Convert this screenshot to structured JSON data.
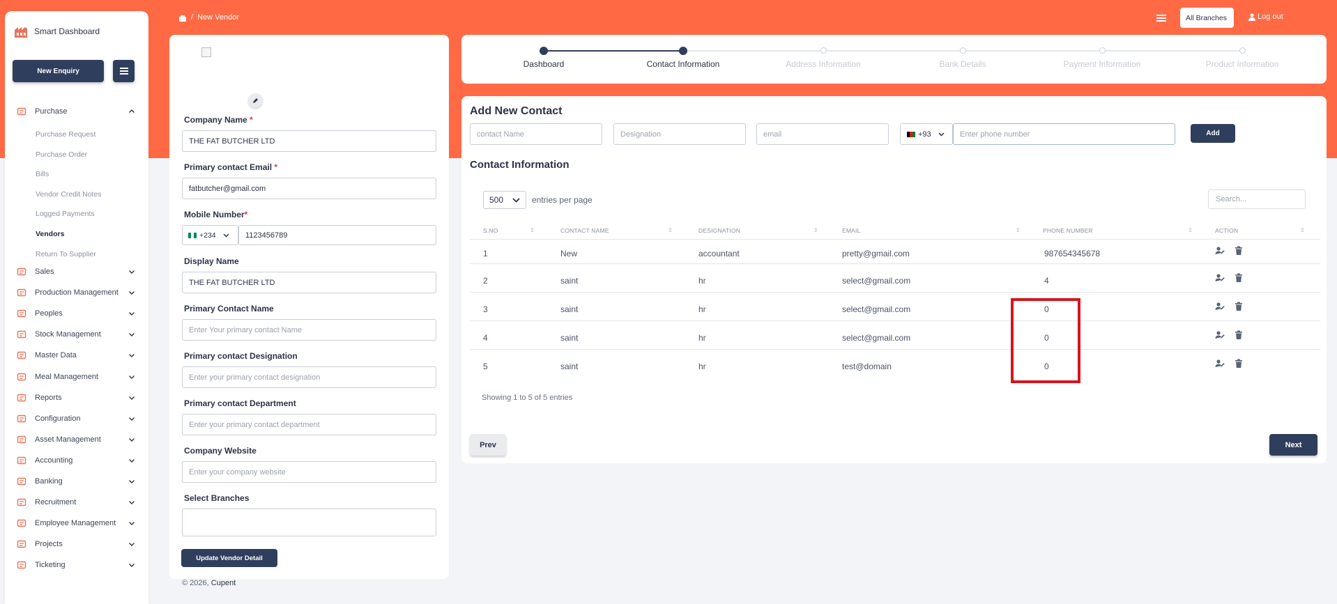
{
  "brand": {
    "name": "Smart Dashboard"
  },
  "sidebar": {
    "new_enquiry": "New Enquiry",
    "purchase": {
      "label": "Purchase",
      "subitems": [
        "Purchase Request",
        "Purchase Order",
        "Bills",
        "Vendor Credit Notes",
        "Logged Payments",
        "Vendors",
        "Return To Supplier"
      ],
      "active": "Vendors"
    },
    "items": [
      "Sales",
      "Production Management",
      "Peoples",
      "Stock Management",
      "Master Data",
      "Meal Management",
      "Reports",
      "Configuration",
      "Asset Management",
      "Accounting",
      "Banking",
      "Recruitment",
      "Employee Management",
      "Projects",
      "Ticketing"
    ]
  },
  "header": {
    "breadcrumb_sep": "/",
    "breadcrumb": "New Vendor",
    "branch_select": "All Branches",
    "logout": "Log out"
  },
  "vendor_form": {
    "company_name": {
      "label": "Company Name",
      "req": "*",
      "value": "THE FAT BUTCHER LTD"
    },
    "email": {
      "label": "Primary contact Email",
      "req": "*",
      "value": "fatbutcher@gmail.com"
    },
    "mobile": {
      "label": "Mobile Number",
      "req": "*",
      "code": "+234",
      "value": "1123456789"
    },
    "display_name": {
      "label": "Display Name",
      "value": "THE FAT BUTCHER LTD"
    },
    "contact_name": {
      "label": "Primary Contact Name",
      "placeholder": "Enter Your primary contact Name"
    },
    "designation": {
      "label": "Primary contact Designation",
      "placeholder": "Enter your primary contact designation"
    },
    "department": {
      "label": "Primary contact Department",
      "placeholder": "Enter your primary contact department"
    },
    "website": {
      "label": "Company Website",
      "placeholder": "Enter your company website"
    },
    "branches": {
      "label": "Select Branches",
      "value": ""
    },
    "update_button": "Update Vendor Detail"
  },
  "footer": {
    "copyright": "© 2026,",
    "company": "Cupent"
  },
  "stepper": {
    "steps": [
      "Dashboard",
      "Contact Information",
      "Address Information",
      "Bank Details",
      "Payment Information",
      "Product Information"
    ],
    "active_index": 1,
    "colors": {
      "done": "#2f3e5c",
      "pending": "#c9ced8",
      "pending_text": "#c6cad3"
    }
  },
  "add_contact": {
    "title": "Add New Contact",
    "name_placeholder": "contact Name",
    "designation_placeholder": "Designation",
    "email_placeholder": "email",
    "phone_code": "+93",
    "phone_placeholder": "Enter phone number",
    "add_button": "Add"
  },
  "contacts": {
    "title": "Contact Information",
    "per_page": "500",
    "per_page_label": "entries per page",
    "search_placeholder": "Search...",
    "columns": [
      "S.NO",
      "CONTACT NAME",
      "DESIGNATION",
      "EMAIL",
      "PHONE NUMBER",
      "ACTION"
    ],
    "rows": [
      {
        "sno": "1",
        "name": "New",
        "designation": "accountant",
        "email": "pretty@gmail.com",
        "phone": "987654345678"
      },
      {
        "sno": "2",
        "name": "saint",
        "designation": "hr",
        "email": "select@gmail.com",
        "phone": "4"
      },
      {
        "sno": "3",
        "name": "saint",
        "designation": "hr",
        "email": "select@gmail.com",
        "phone": "0"
      },
      {
        "sno": "4",
        "name": "saint",
        "designation": "hr",
        "email": "select@gmail.com",
        "phone": "0"
      },
      {
        "sno": "5",
        "name": "saint",
        "designation": "hr",
        "email": "test@domain",
        "phone": "0"
      }
    ],
    "info": "Showing 1 to 5 of 5 entries",
    "prev": "Prev",
    "next": "Next"
  },
  "colors": {
    "accent": "#ff6a45",
    "primary": "#2f3e5c",
    "highlight": "#d8141c",
    "icon": "#e8735a"
  }
}
